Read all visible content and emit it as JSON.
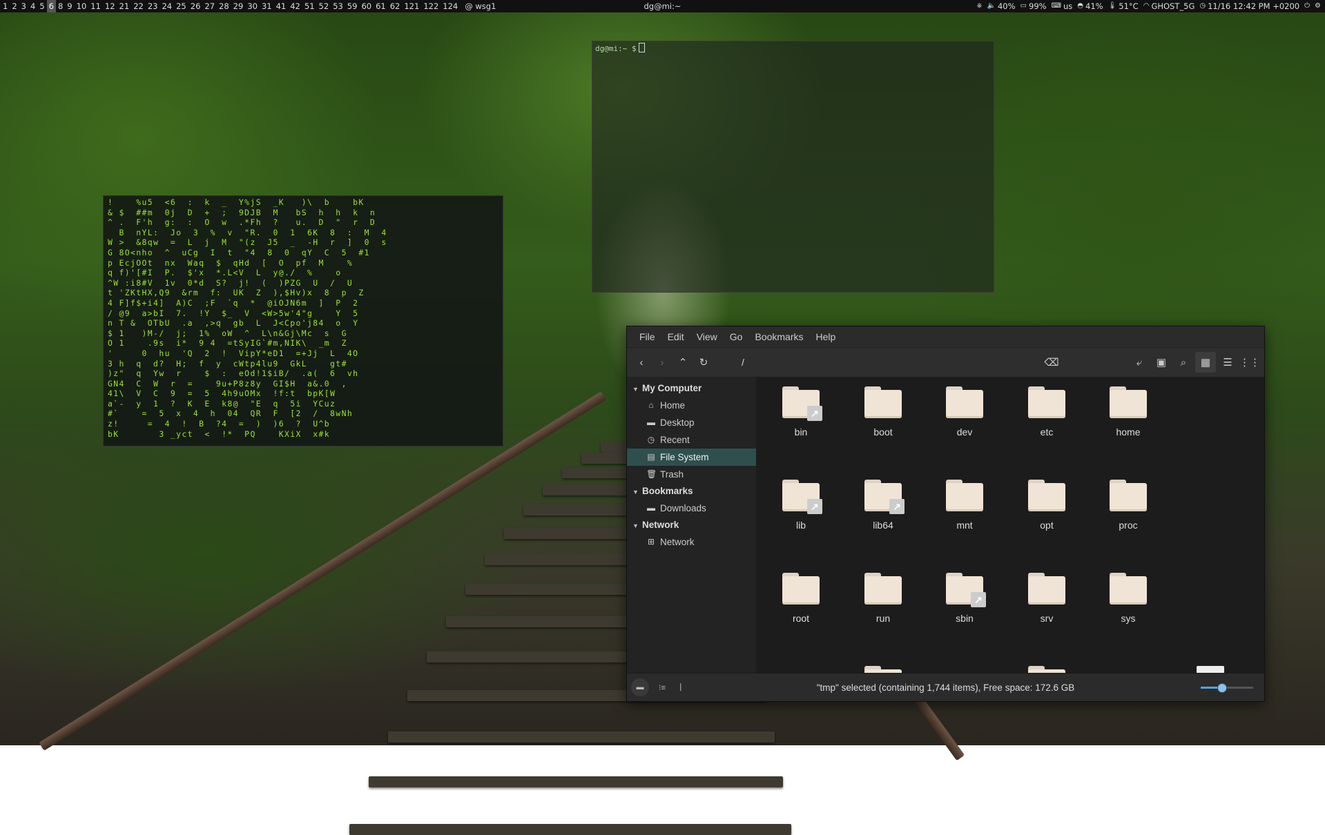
{
  "topbar": {
    "workspaces": [
      "1",
      "2",
      "3",
      "4",
      "5",
      "6",
      "8",
      "9",
      "10",
      "11",
      "12",
      "21",
      "22",
      "23",
      "24",
      "25",
      "26",
      "27",
      "28",
      "29",
      "30",
      "31",
      "41",
      "42",
      "51",
      "52",
      "53",
      "59",
      "60",
      "61",
      "62",
      "121",
      "122",
      "124"
    ],
    "active_workspace": "6",
    "scratch_label": "@ wsg1",
    "window_title": "dg@mi:~",
    "status": {
      "cpu_icon": "chip-icon",
      "volume": "40%",
      "battery": "99%",
      "keyboard": "us",
      "disk": "41%",
      "temperature": "51°C",
      "wifi": "GHOST_5G",
      "datetime": "11/16 12:42 PM +0200"
    }
  },
  "matrix_terminal": {
    "lines": [
      "!    %u5  <6  :  k  _  Y%jS  _K   )\\  b    bK",
      "& $  ##m  0j  D  +  ;  9DJB  M   bS  h  h  k  n",
      "^ .  F'h  g:  :  O  w  .*Fh  ?   u.  D  \"  r  D",
      "  B  nYL:  Jo  3  %  v  \"R.  0  1  6K  8  :  M  4",
      "W >  &8qw  =  L  j  M  \"(z  J5  _  -H  r  ]  0  s",
      "G 8O<nho  ^  uCg  I  t  \"4  8  0  qY  C  5  #1",
      "p EcjOOt  nx  Waq  $  qHd  [  O  pf  M    %",
      "q f)'[#I  P.  $'x  *.L<V  L  y@./  %    o",
      "^W :i8#V  1v  0*d  S?  j!  (  )PZG  U  /  U",
      "t 'ZKtHX,Q9  &rm  f:  UK  Z  ),$Hv)x  8  p  Z",
      "4 F]f$+i4]  A)C  ;F  `q  *  @iOJN6m  ]  P  2",
      "/ @9  a>bI  7.  !Y  $_  V  <W>5w'4\"g    Y  5",
      "n T &  OTbU  .a  ,>q  gb  L  J<Cpo'j84  o  Y",
      "$ 1   )M-/  j;  1%  oW  ^  L\\n&Gj\\Mc  s  G",
      "O 1    .9s  i*  9 4  =tSyIG`#m,NIK\\  _m  Z",
      "'     0  hu  'Q  2  !  VipY*eD1  =+Jj  L  4O",
      "3 h  q  d?  H;  f  y  cWtp4lu9  GkL    gt#",
      ")z\"  q  Yw  r    $  :  eOd!1$iB/  .a(  6  vh",
      "GN4  C  W  r  =    9u+P8z8y  GI$H  a&.0  ,",
      "41\\  V  C  9  =  5  4h9uOMx  !f:t  bpK[W",
      "a`-  y  1  ?  K  E  k8@  \"E  q  5i  YCuz",
      "#`    =  5  x  4  h  04  QR  F  [2  /  8wNh",
      "z!     =  4  !  B  ?4  =  )  )6  ?  U^b",
      "bK       3 _yct  <  !*  PQ    KXiX  x#k"
    ]
  },
  "shell_terminal": {
    "prompt": "dg@mi:~ $"
  },
  "file_manager": {
    "menu": [
      "File",
      "Edit",
      "View",
      "Go",
      "Bookmarks",
      "Help"
    ],
    "path": "/",
    "sidebar": {
      "sections": [
        {
          "title": "My Computer",
          "items": [
            {
              "label": "Home",
              "icon": "home-icon"
            },
            {
              "label": "Desktop",
              "icon": "folder-icon"
            },
            {
              "label": "Recent",
              "icon": "clock-icon"
            },
            {
              "label": "File System",
              "icon": "drive-icon",
              "selected": true
            },
            {
              "label": "Trash",
              "icon": "trash-icon"
            }
          ]
        },
        {
          "title": "Bookmarks",
          "items": [
            {
              "label": "Downloads",
              "icon": "folder-icon"
            }
          ]
        },
        {
          "title": "Network",
          "items": [
            {
              "label": "Network",
              "icon": "network-icon"
            }
          ]
        }
      ]
    },
    "folders": [
      {
        "name": "bin",
        "link": true
      },
      {
        "name": "boot",
        "link": false
      },
      {
        "name": "dev",
        "link": false
      },
      {
        "name": "etc",
        "link": false
      },
      {
        "name": "home",
        "link": false
      },
      {
        "name": "lib",
        "link": true
      },
      {
        "name": "lib64",
        "link": true
      },
      {
        "name": "mnt",
        "link": false
      },
      {
        "name": "opt",
        "link": false
      },
      {
        "name": "proc",
        "link": false
      },
      {
        "name": "root",
        "link": false
      },
      {
        "name": "run",
        "link": false
      },
      {
        "name": "sbin",
        "link": true
      },
      {
        "name": "srv",
        "link": false
      },
      {
        "name": "sys",
        "link": false
      }
    ],
    "status_text": "\"tmp\" selected (containing 1,744 items), Free space: 172.6 GB",
    "zoom_level": 0.4
  }
}
